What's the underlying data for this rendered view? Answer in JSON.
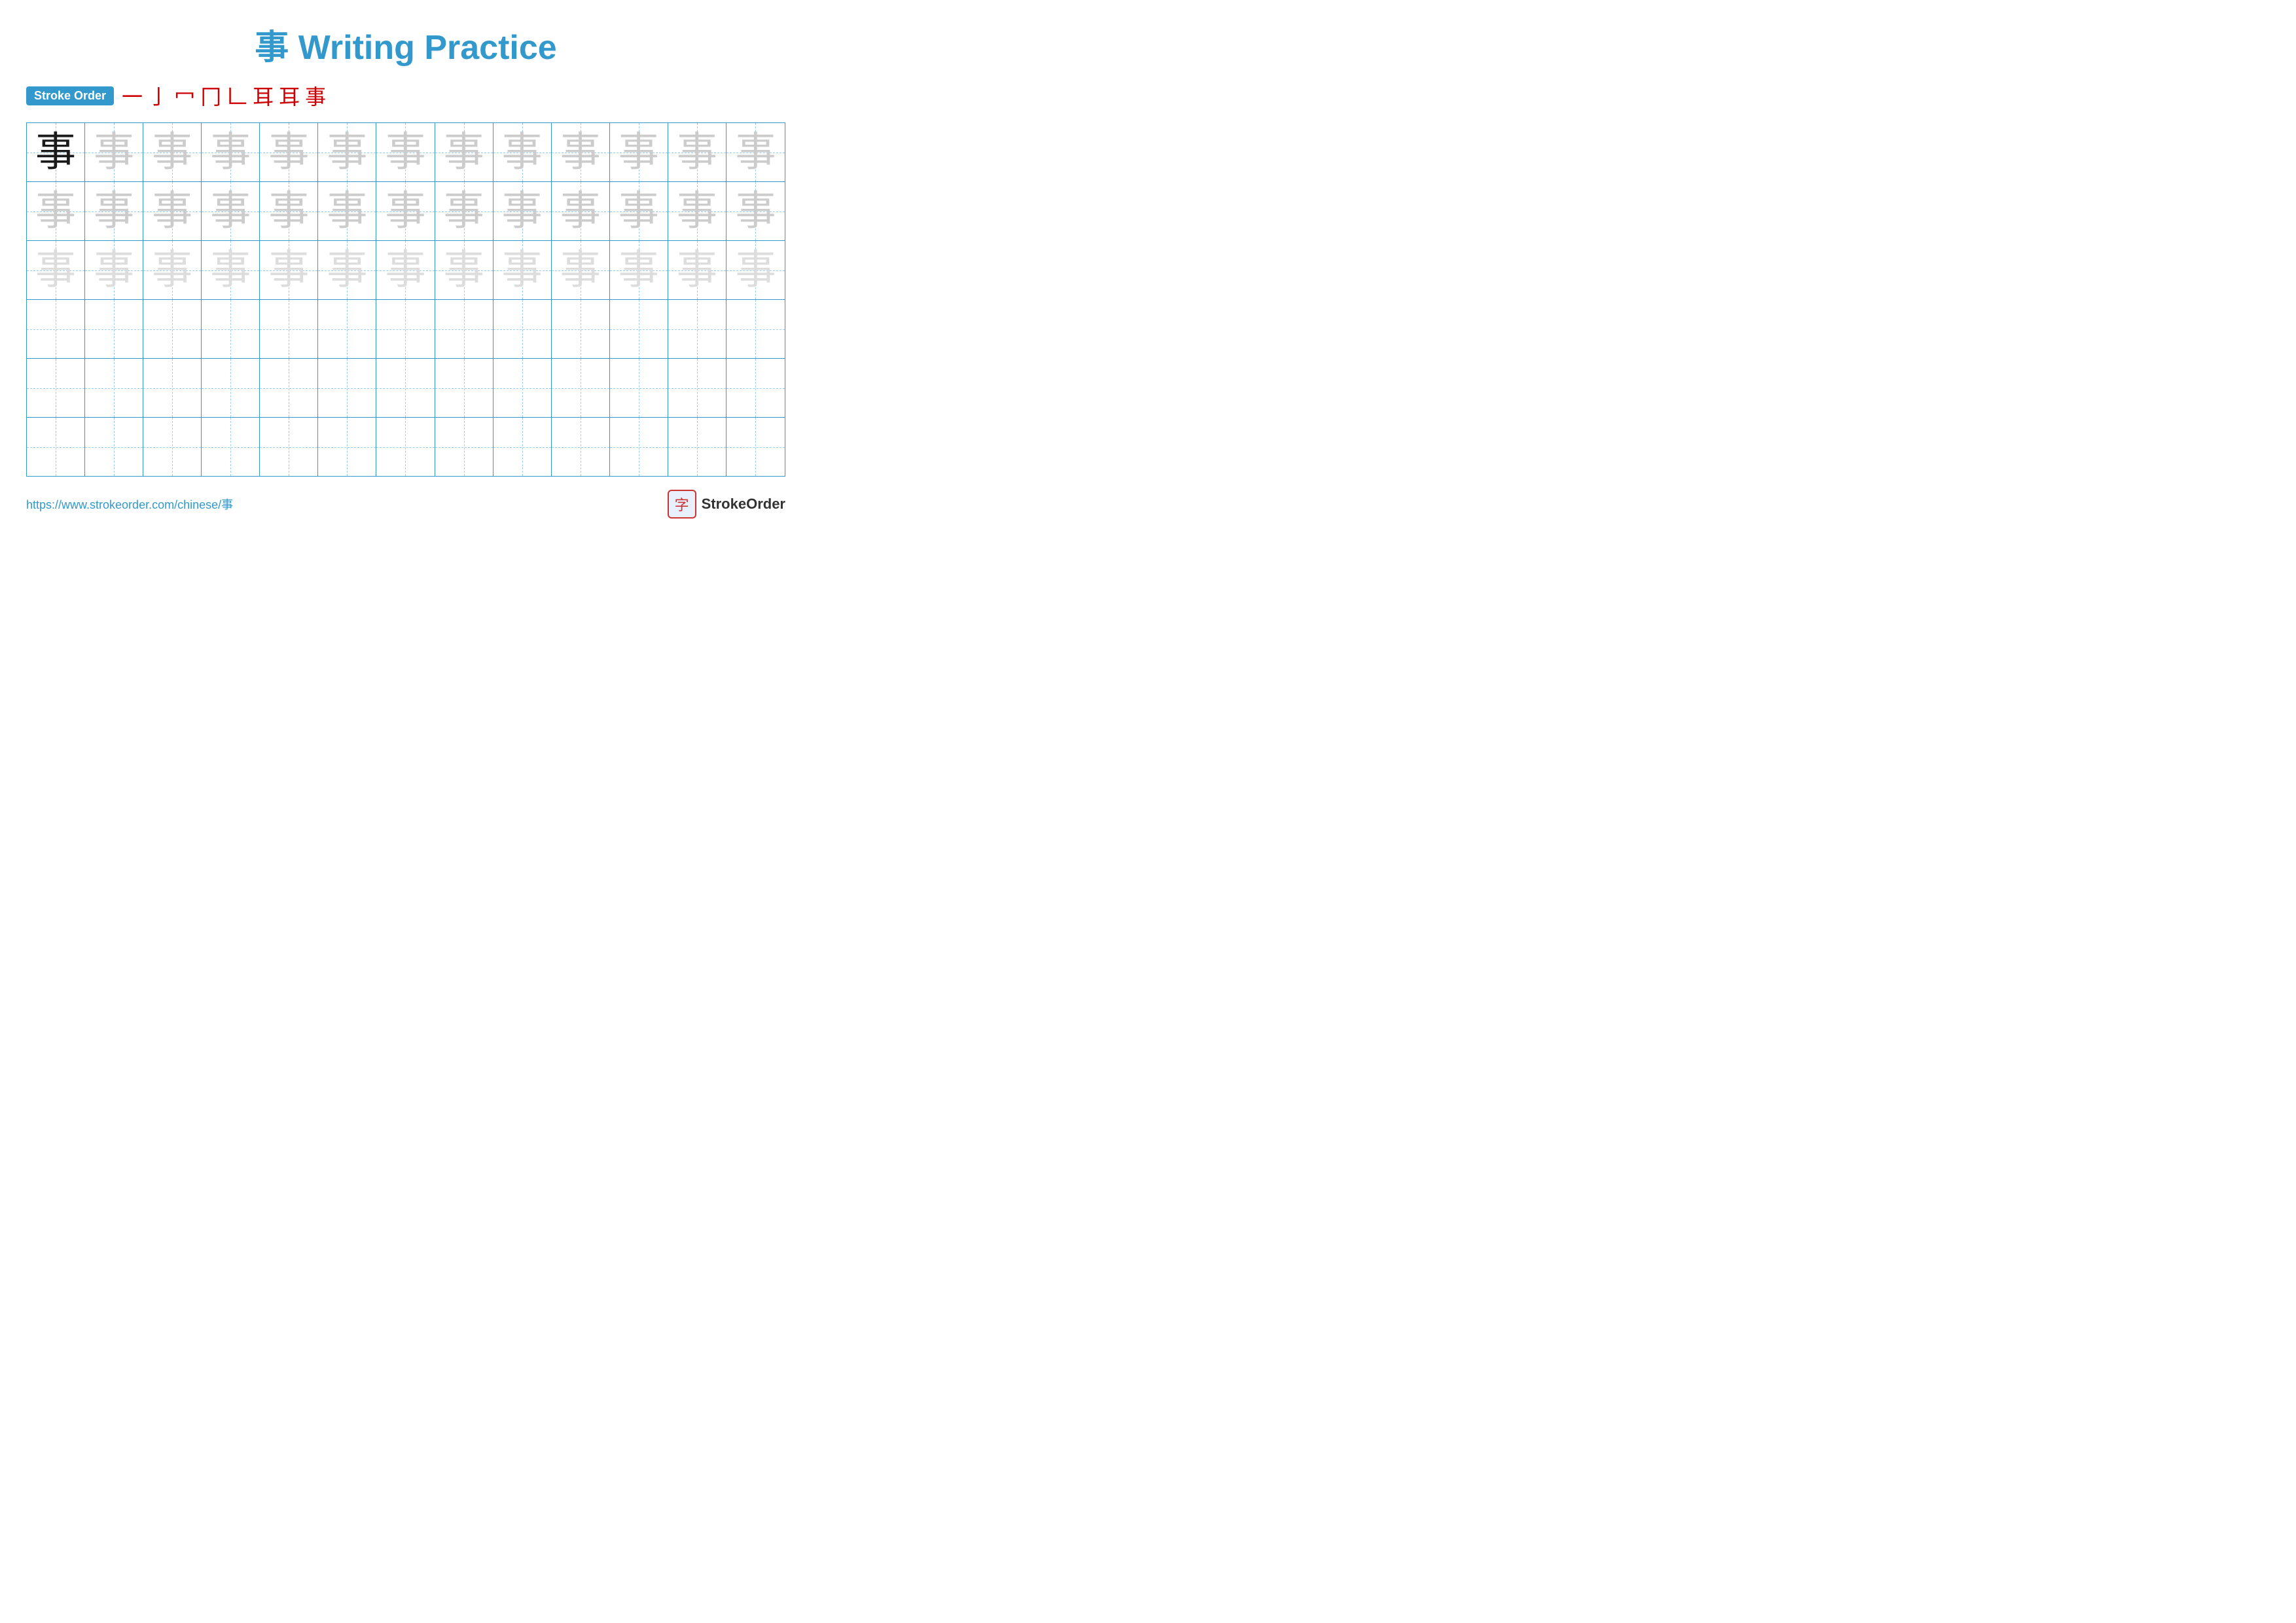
{
  "title": {
    "char": "事",
    "text": "Writing Practice",
    "full": "事 Writing Practice"
  },
  "stroke_order": {
    "badge_label": "Stroke Order",
    "strokes": [
      "一",
      "亅",
      "冖",
      "冂",
      "𠃊",
      "耳",
      "耳",
      "事"
    ]
  },
  "grid": {
    "rows": 6,
    "cols": 13,
    "char": "事",
    "row_types": [
      "dark_then_light",
      "light",
      "lighter",
      "empty",
      "empty",
      "empty"
    ]
  },
  "footer": {
    "url": "https://www.strokeorder.com/chinese/事",
    "logo_char": "字",
    "logo_text": "StrokeOrder"
  }
}
